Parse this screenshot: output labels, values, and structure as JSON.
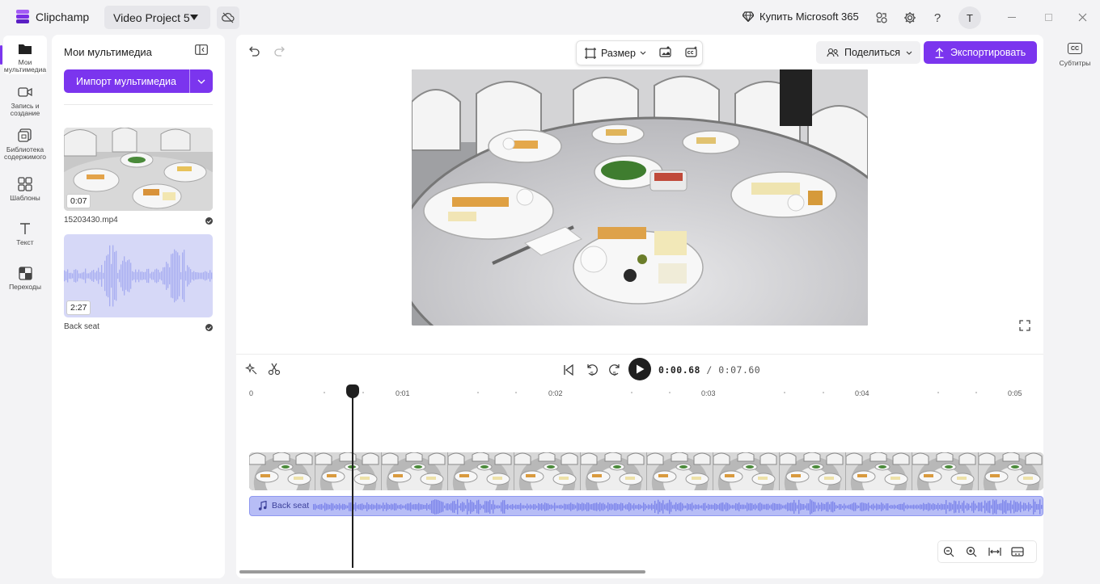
{
  "app": {
    "name": "Clipchamp",
    "project_title": "Video Project 5"
  },
  "topbar": {
    "buy_label": "Купить Microsoft 365",
    "avatar_initial": "T"
  },
  "rail": {
    "items": [
      {
        "label": "Мои мультимедиа",
        "icon": "folder-icon"
      },
      {
        "label": "Запись и создание",
        "icon": "camera-icon"
      },
      {
        "label": "Библиотека содержимого",
        "icon": "library-icon"
      },
      {
        "label": "Шаблоны",
        "icon": "templates-icon"
      },
      {
        "label": "Текст",
        "icon": "text-icon"
      },
      {
        "label": "Переходы",
        "icon": "transitions-icon"
      }
    ]
  },
  "media_panel": {
    "title": "Мои мультимедиа",
    "import_label": "Импорт мультимедиа",
    "items": [
      {
        "duration": "0:07",
        "name": "15203430.mp4"
      },
      {
        "duration": "2:27",
        "name": "Back seat"
      }
    ]
  },
  "editor": {
    "size_label": "Размер",
    "share_label": "Поделиться",
    "export_label": "Экспортировать"
  },
  "timeline": {
    "current_time": "0:00.68",
    "total_time": "0:07.60",
    "ruler_labels": [
      "0",
      "0:01",
      "0:02",
      "0:03",
      "0:04",
      "0:05"
    ],
    "audio_track_label": "Back seat"
  },
  "right_rail": {
    "subtitles_label": "Субтитры",
    "cc_glyph": "CC"
  },
  "colors": {
    "accent": "#7b35ee",
    "audio_track": "#b7bdf6"
  }
}
